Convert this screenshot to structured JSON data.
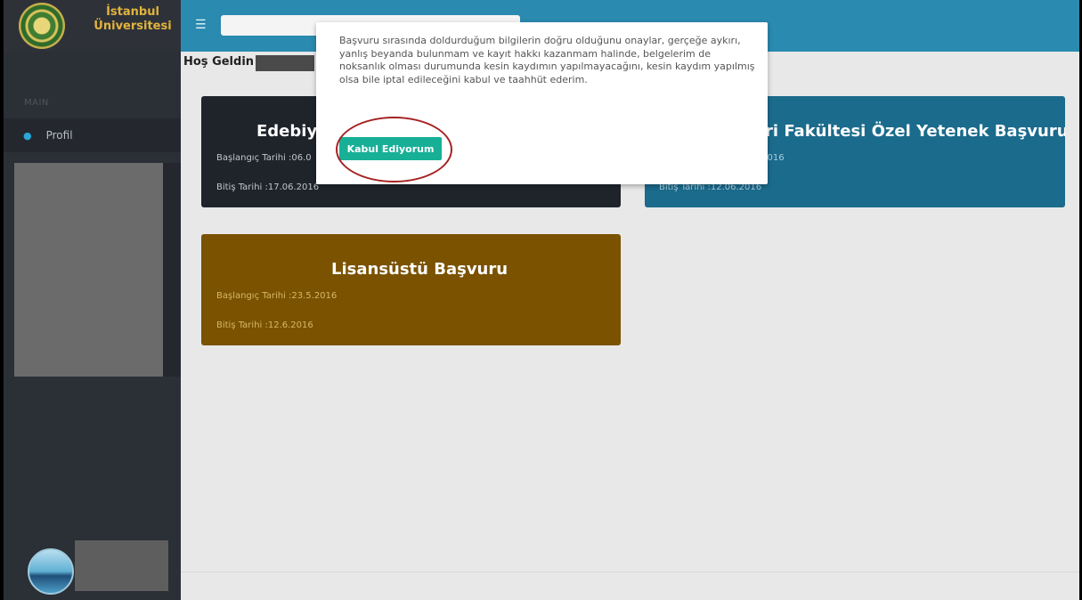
{
  "brand": {
    "line1": "İstanbul",
    "line2": "Üniversitesi"
  },
  "sidebar": {
    "section_label": "MAIN",
    "items": [
      {
        "label": "Profil",
        "icon": "user-icon"
      }
    ]
  },
  "topbar": {
    "menu_icon": "hamburger-icon",
    "search_placeholder": ""
  },
  "welcome": {
    "text": "Hoş Geldin"
  },
  "cards": [
    {
      "title": "Edebiyat",
      "start": "Başlangıç Tarihi :06.0",
      "end": "Bitiş Tarihi :17.06.2016",
      "color": "#1f242b"
    },
    {
      "title": "ri Fakültesi Özel Yetenek Başvuru",
      "start": ".2016",
      "end": "Bitiş Tarihi :12.06.2016",
      "color": "#1b6b8c"
    },
    {
      "title": "Lisansüstü Başvuru",
      "start": "Başlangıç Tarihi :23.5.2016",
      "end": "Bitiş Tarihi :12.6.2016",
      "color": "#7a5200"
    }
  ],
  "modal": {
    "text": "Başvuru sırasında doldurduğum bilgilerin doğru olduğunu onaylar, gerçeğe aykırı, yanlış beyanda bulunmam ve kayıt hakkı kazanmam halinde, belgelerim de noksanlık olması durumunda kesin kaydımın yapılmayacağını, kesin kaydım yapılmış olsa bile iptal edileceğini kabul ve taahhüt ederim.",
    "button_label": "Kabul Ediyorum",
    "accent": "#17b097"
  }
}
